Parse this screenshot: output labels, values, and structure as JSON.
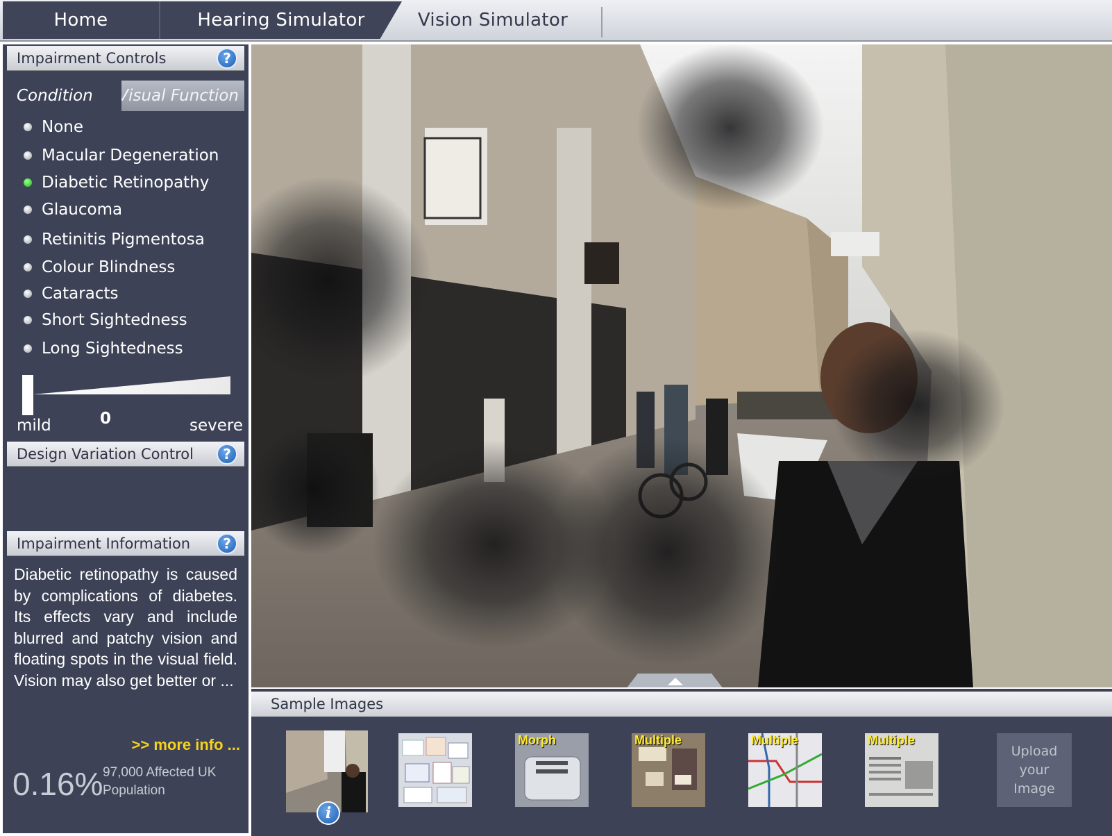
{
  "nav": {
    "tabs": [
      {
        "label": "Home"
      },
      {
        "label": "Hearing Simulator"
      },
      {
        "label": "Vision Simulator"
      }
    ],
    "active": "Vision Simulator"
  },
  "impairment_controls": {
    "title": "Impairment Controls",
    "help_label": "?",
    "subtabs": [
      "Condition",
      "Visual Function"
    ],
    "conditions": [
      {
        "label": "None",
        "selected": false
      },
      {
        "label": "Macular Degeneration",
        "selected": false
      },
      {
        "label": "Diabetic Retinopathy",
        "selected": true
      },
      {
        "label": "Glaucoma",
        "selected": false
      },
      {
        "label": "Retinitis Pigmentosa",
        "selected": false
      },
      {
        "label": "Colour Blindness",
        "selected": false
      },
      {
        "label": "Cataracts",
        "selected": false
      },
      {
        "label": "Short Sightedness",
        "selected": false
      },
      {
        "label": "Long Sightedness",
        "selected": false
      }
    ],
    "severity": {
      "min_label": "mild",
      "max_label": "severe",
      "value": "0"
    }
  },
  "design_variation": {
    "title": "Design Variation Control",
    "help_label": "?"
  },
  "impairment_info": {
    "title": "Impairment Information",
    "help_label": "?",
    "text": "Diabetic retinopathy is caused by complications of diabetes. Its effects vary and include blurred and patchy vision and floating spots in the visual field. Vision may also get better or ...",
    "more_info": ">> more info ...",
    "stat_percent": "0.16%",
    "stat_caption": "97,000 Affected UK Population"
  },
  "sample_images": {
    "title": "Sample Images",
    "thumbnails": [
      {
        "label": "",
        "icon": "street-scene"
      },
      {
        "label": "",
        "icon": "medicine-packets"
      },
      {
        "label": "Morph",
        "icon": "toaster"
      },
      {
        "label": "Multiple",
        "icon": "control-panel"
      },
      {
        "label": "Multiple",
        "icon": "transit-map"
      },
      {
        "label": "Multiple",
        "icon": "newspaper"
      }
    ],
    "info_badge": "i",
    "upload_label": "Upload your Image"
  },
  "colors": {
    "panel_bg": "#3d4256",
    "selected_dot": "#1fb51f",
    "link_yellow": "#f5d21c",
    "help_blue": "#1f5fb3"
  }
}
